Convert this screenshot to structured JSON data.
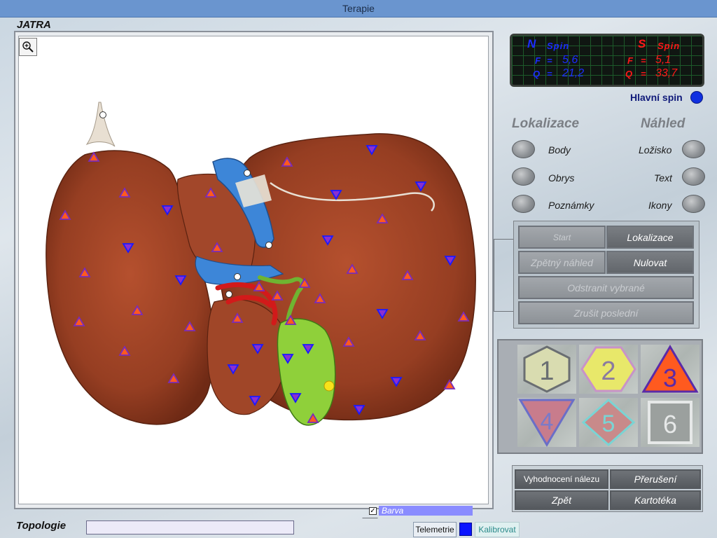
{
  "window": {
    "title": "Terapie"
  },
  "section": {
    "title": "JATRA"
  },
  "spin": {
    "n_label": "N",
    "n_spin": "Spin",
    "n_f_label": "F",
    "n_f_value": "5,6",
    "n_q_label": "Q",
    "n_q_value": "21,2",
    "s_label": "S",
    "s_spin": "Spin",
    "s_f_label": "F",
    "s_f_value": "5,1",
    "s_q_label": "Q",
    "s_q_value": "33,7",
    "eq": "=",
    "main_label": "Hlavní spin"
  },
  "headers": {
    "lokalizace": "Lokalizace",
    "nahled": "Náhled"
  },
  "options_left": [
    "Body",
    "Obrys",
    "Poznámky"
  ],
  "options_right": [
    "Ložisko",
    "Text",
    "Ikony"
  ],
  "controls": {
    "start": "Start",
    "lokalizace": "Lokalizace",
    "zpetny": "Zpětný náhled",
    "nulovat": "Nulovat",
    "odstranit": "Odstranit vybrané",
    "zrusit": "Zrušit poslední"
  },
  "icons": [
    "1",
    "2",
    "3",
    "4",
    "5",
    "6"
  ],
  "bottom": {
    "vyhodnoceni": "Vyhodnocení nálezu",
    "preruseni": "Přerušení",
    "zpet": "Zpět",
    "kartoteka": "Kartotéka"
  },
  "barva": {
    "label": "Barva",
    "checked": true
  },
  "topologie": {
    "label": "Topologie",
    "value": ""
  },
  "footer": {
    "telemetrie": "Telemetrie",
    "kalibrovat": "Kalibrovat"
  },
  "colors": {
    "title_bar": "#6a95cf",
    "north": "#1c2cff",
    "south": "#ff1818",
    "main_spin": "#1030e0"
  }
}
